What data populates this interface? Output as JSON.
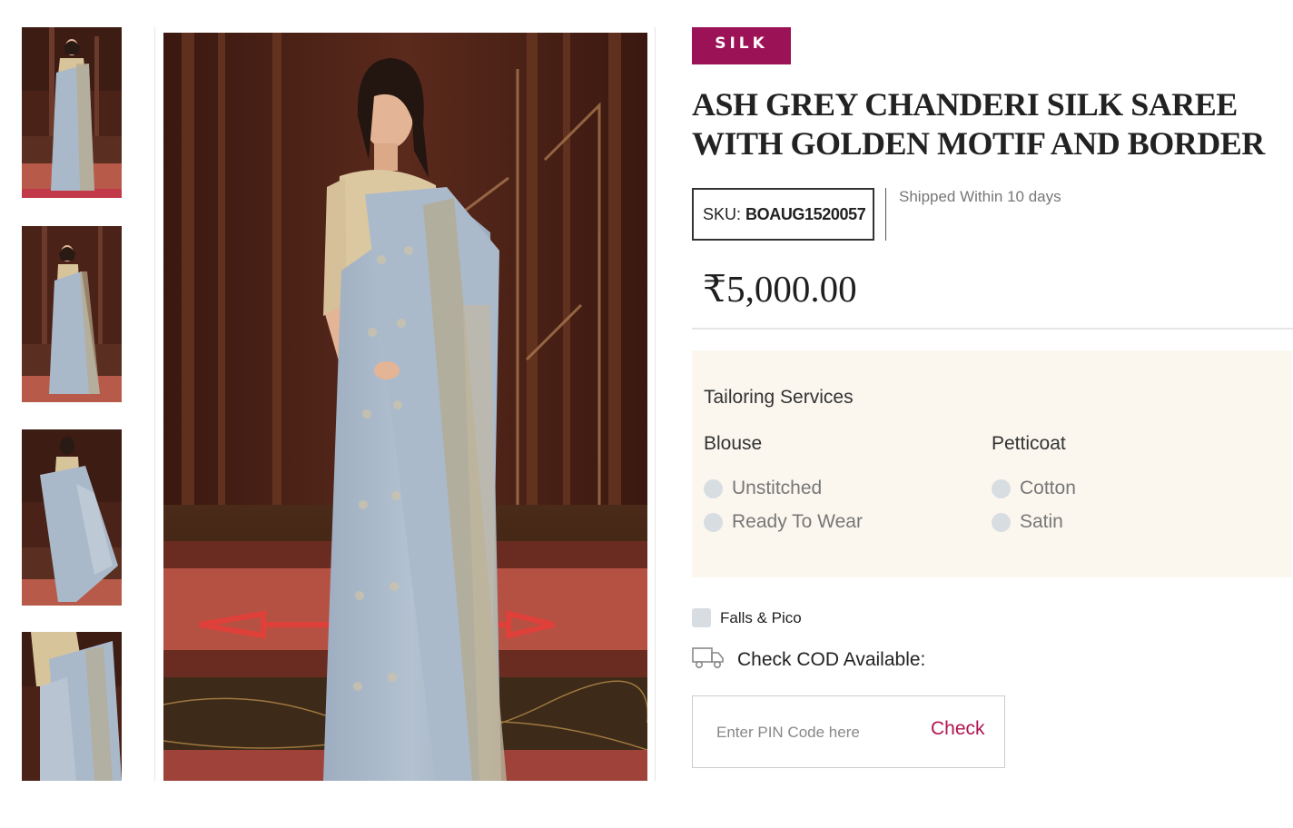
{
  "gallery": {
    "thumbnails": [
      {
        "name": "thumbnail-1",
        "view": "front"
      },
      {
        "name": "thumbnail-2",
        "view": "side"
      },
      {
        "name": "thumbnail-3",
        "view": "back"
      },
      {
        "name": "thumbnail-4",
        "view": "drape-closeup"
      }
    ],
    "main_image": "saree-model-front"
  },
  "product": {
    "category": "SILK",
    "title": "ASH GREY CHANDERI SILK SAREE WITH GOLDEN MOTIF AND BORDER",
    "sku_label": "SKU:",
    "sku_value": "BOAUG1520057",
    "shipping": "Shipped Within 10 days",
    "price": "₹5,000.00"
  },
  "tailoring": {
    "title": "Tailoring Services",
    "blouse": {
      "title": "Blouse",
      "options": [
        "Unstitched",
        "Ready To Wear"
      ]
    },
    "petticoat": {
      "title": "Petticoat",
      "options": [
        "Cotton",
        "Satin"
      ]
    }
  },
  "extras": {
    "falls_pico": "Falls & Pico"
  },
  "cod": {
    "icon": "delivery-truck-icon",
    "label": "Check COD Available:",
    "pin_placeholder": "Enter PIN Code here",
    "check_label": "Check"
  },
  "colors": {
    "badge": "#9c1256",
    "accent": "#b0154f",
    "panel": "#fbf7ee",
    "saree": "#aab9c9"
  }
}
